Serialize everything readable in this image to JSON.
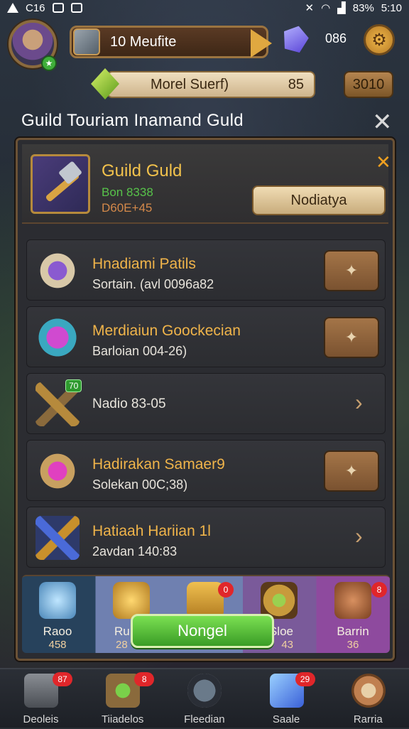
{
  "status_bar": {
    "time": "C16",
    "battery": "83%",
    "clock": "5:10"
  },
  "top_bar": {
    "player_name": "10 Meufite",
    "gem_count": "086"
  },
  "resource": {
    "label": "Morel Suerf)",
    "value": "85",
    "button_label": "3010"
  },
  "panel": {
    "title": "Guild Touriam Inamand Guld"
  },
  "guild_card": {
    "name": "Guild Guld",
    "line1": "Bon 8338",
    "line2": "D60E+45",
    "button_label": "Nodiatya"
  },
  "rows": [
    {
      "title": "Hnadiami Patils",
      "subtitle": "Sortain. (avl 0096a82",
      "action": "button"
    },
    {
      "title": "Merdiaiun Goockecian",
      "subtitle": "Barloian 004-26)",
      "action": "button"
    },
    {
      "title": "",
      "subtitle": "Nadio 83-05",
      "badge": "70",
      "action": "chevron"
    },
    {
      "title": "Hadirakan Samaer9",
      "subtitle": "Solekan 00C;38)",
      "action": "button"
    },
    {
      "title": "Hatiaah Hariian 1l",
      "subtitle": "2avdan 140:83",
      "action": "chevron"
    }
  ],
  "inventory": [
    {
      "label": "Raoo",
      "count": "458"
    },
    {
      "label": "Ru",
      "count": "28"
    },
    {
      "label": "",
      "count": "",
      "badge": "0"
    },
    {
      "label": "Sloe",
      "count": "43"
    },
    {
      "label": "Barrin",
      "count": "36",
      "badge": "8"
    }
  ],
  "main_button": {
    "label": "Nongel"
  },
  "bottom_nav": [
    {
      "label": "Deoleis",
      "badge": "87"
    },
    {
      "label": "Tiiadelos",
      "badge": "8"
    },
    {
      "label": "Fleedian",
      "badge": ""
    },
    {
      "label": "Saale",
      "badge": "29"
    },
    {
      "label": "Rarria",
      "badge": ""
    }
  ]
}
